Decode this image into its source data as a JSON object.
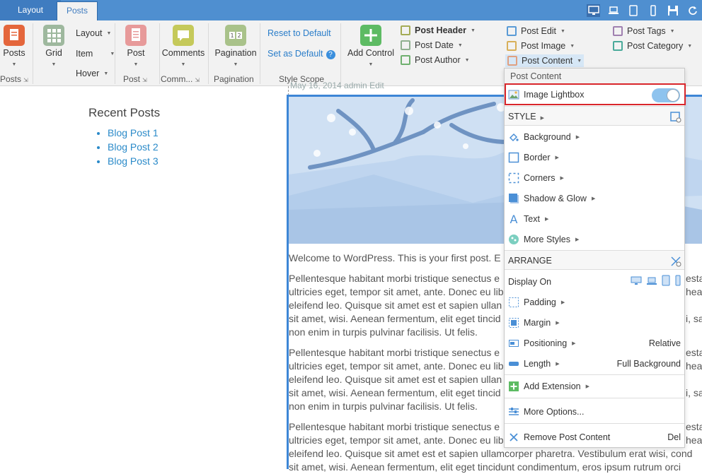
{
  "tabs": {
    "layout": "Layout",
    "posts": "Posts"
  },
  "colors": {
    "accent": "#4f8fd0",
    "highlight": "#d9262b",
    "link": "#2a7dc9"
  },
  "ribbon": {
    "posts_btn": "Posts",
    "posts_group": "Posts",
    "grid_btn": "Grid",
    "layout_item": "Layout",
    "item_item": "Item",
    "hover_item": "Hover",
    "post_btn": "Post",
    "post_group": "Post",
    "comments_btn": "Comments",
    "comments_group": "Comm...",
    "pagination_btn": "Pagination",
    "pagination_group": "Pagination",
    "reset_default": "Reset to Default",
    "set_default": "Set as Default",
    "help": "?",
    "style_scope": "Style Scope",
    "add_control": "Add Control",
    "post_header": "Post Header",
    "post_date": "Post Date",
    "post_author": "Post Author",
    "post_edit": "Post Edit",
    "post_image": "Post Image",
    "post_content": "Post Content",
    "post_tags": "Post Tags",
    "post_category": "Post Category"
  },
  "sidebar": {
    "title": "Recent Posts",
    "items": [
      "Blog Post 1",
      "Blog Post 2",
      "Blog Post 3"
    ]
  },
  "post": {
    "meta": "May 16, 2014    admin    Edit",
    "lines": [
      "Welcome to WordPress. This is your first post. E",
      "Pellentesque habitant morbi tristique senectus e",
      "ultricies eget, tempor sit amet, ante. Donec eu lib",
      "eleifend leo. Quisque sit amet est et sapien ullan",
      "sit amet, wisi. Aenean fermentum, elit eget tincid",
      "non enim in turpis pulvinar facilisis. Ut felis.",
      "Pellentesque habitant morbi tristique senectus e",
      "ultricies eget, tempor sit amet, ante. Donec eu lib",
      "eleifend leo. Quisque sit amet est et sapien ullan",
      "sit amet, wisi. Aenean fermentum, elit eget tincid",
      "non enim in turpis pulvinar facilisis. Ut felis.",
      "Pellentesque habitant morbi tristique senectus e",
      "ultricies eget, tempor sit amet, ante. Donec eu lib",
      "eleifend leo. Quisque sit amet est et sapien ullamcorper pharetra. Vestibulum erat wisi, cond",
      "sit amet, wisi. Aenean fermentum, elit eget tincidunt condimentum, eros ipsum rutrum orci"
    ],
    "right_clips": [
      "esta",
      "hear",
      "i, sa",
      "esta",
      "hear",
      "i, sa",
      "esta",
      "hear"
    ]
  },
  "panel": {
    "header": "Post Content",
    "lightbox_label": "Image Lightbox",
    "lightbox_on": true,
    "style_title": "STYLE",
    "background": "Background",
    "border": "Border",
    "corners": "Corners",
    "shadow": "Shadow & Glow",
    "text": "Text",
    "more_styles": "More Styles",
    "arrange_title": "ARRANGE",
    "display_on": "Display On",
    "padding": "Padding",
    "margin": "Margin",
    "positioning": "Positioning",
    "positioning_value": "Relative",
    "length": "Length",
    "length_value": "Full Background",
    "add_extension": "Add Extension",
    "more_options": "More Options...",
    "remove": "Remove Post Content",
    "remove_shortcut": "Del"
  }
}
